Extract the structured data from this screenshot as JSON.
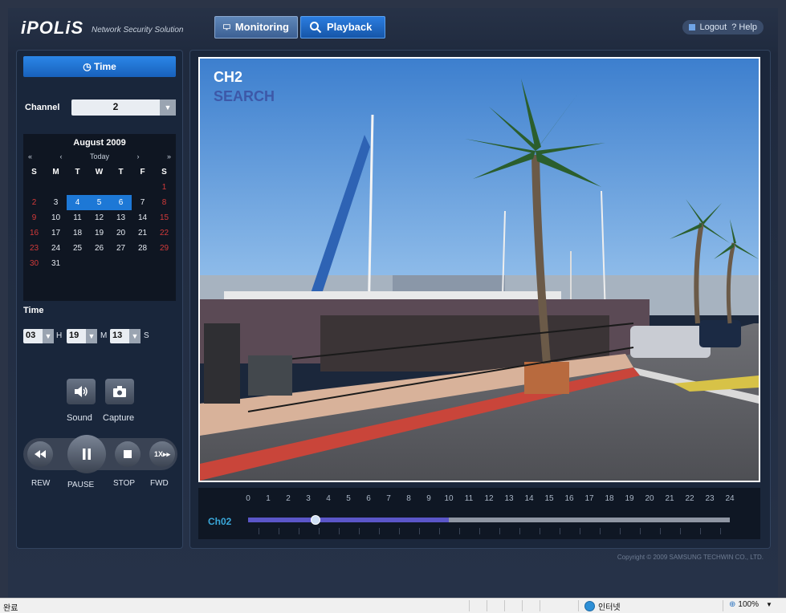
{
  "header": {
    "logo": "iPOLiS",
    "logo_subtitle": "Network Security Solution",
    "tab_monitoring": "Monitoring",
    "tab_playback": "Playback",
    "logout": "Logout",
    "help": "? Help"
  },
  "left": {
    "time_tab": "Time",
    "channel_label": "Channel",
    "channel_value": "2",
    "calendar": {
      "title": "August 2009",
      "nav": [
        "«",
        "‹",
        "Today",
        "›",
        "»"
      ],
      "weekdays": [
        "S",
        "M",
        "T",
        "W",
        "T",
        "F",
        "S"
      ],
      "days": [
        [
          "",
          "",
          "",
          "",
          "",
          "",
          "1"
        ],
        [
          "2",
          "3",
          "4",
          "5",
          "6",
          "7",
          "8"
        ],
        [
          "9",
          "10",
          "11",
          "12",
          "13",
          "14",
          "15"
        ],
        [
          "16",
          "17",
          "18",
          "19",
          "20",
          "21",
          "22"
        ],
        [
          "23",
          "24",
          "25",
          "26",
          "27",
          "28",
          "29"
        ],
        [
          "30",
          "31",
          "",
          "",
          "",
          "",
          ""
        ]
      ],
      "recorded_days": [
        "4",
        "5",
        "6"
      ]
    },
    "time_label": "Time",
    "hour": "03",
    "hour_unit": "H",
    "minute": "19",
    "minute_unit": "M",
    "second": "13",
    "second_unit": "S",
    "sound_label": "Sound",
    "capture_label": "Capture",
    "rew_label": "REW",
    "pause_label": "PAUSE",
    "stop_label": "STOP",
    "fwd_label": "FWD",
    "fwd_speed": "1X"
  },
  "viewer": {
    "channel": "CH2",
    "mode": "SEARCH"
  },
  "timeline": {
    "channel_label": "Ch02",
    "hours": [
      "0",
      "1",
      "2",
      "3",
      "4",
      "5",
      "6",
      "7",
      "8",
      "9",
      "10",
      "11",
      "12",
      "13",
      "14",
      "15",
      "16",
      "17",
      "18",
      "19",
      "20",
      "21",
      "22",
      "23",
      "24"
    ],
    "recorded_until_hour": 10,
    "playhead_hour": 3.3
  },
  "copyright": "Copyright © 2009 SAMSUNG TECHWIN CO., LTD.",
  "statusbar": {
    "left": "완료",
    "zone": "인터넷",
    "zoom": "100%"
  },
  "colors": {
    "accent": "#1d78d6",
    "weekend": "#d33a3a",
    "timeline_recorded": "#5b56c8"
  }
}
